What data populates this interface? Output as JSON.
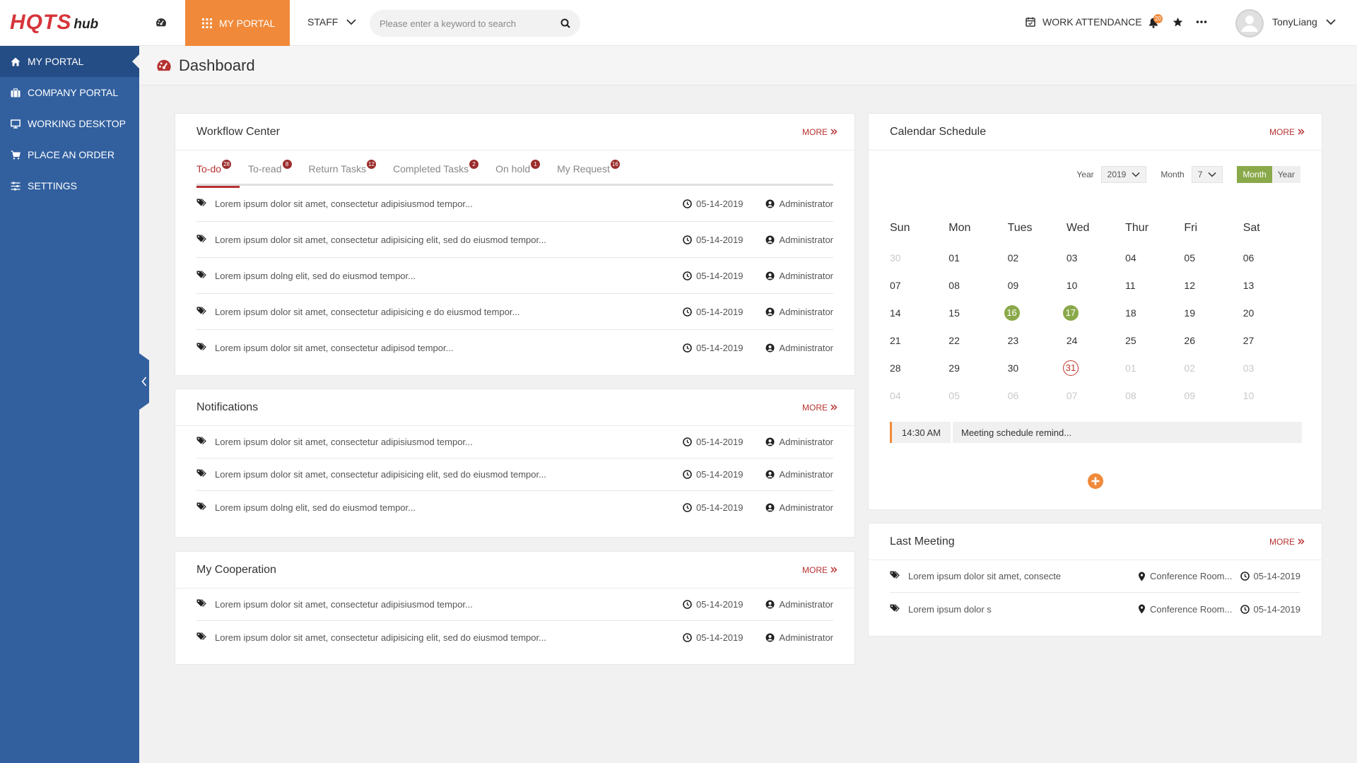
{
  "brand": {
    "logo_main": "HQTS",
    "logo_sub": "hub"
  },
  "topbar": {
    "portal_tab": "MY PORTAL",
    "staff_menu": "STAFF",
    "search_placeholder": "Please enter a keyword to search",
    "work_attendance": "WORK ATTENDANCE",
    "notification_count": "20",
    "username": "TonyLiang"
  },
  "sidebar": {
    "items": [
      {
        "label": "MY PORTAL",
        "icon": "home-icon"
      },
      {
        "label": "COMPANY PORTAL",
        "icon": "briefcase-icon"
      },
      {
        "label": "WORKING DESKTOP",
        "icon": "monitor-icon"
      },
      {
        "label": "PLACE AN ORDER",
        "icon": "cart-icon"
      },
      {
        "label": "SETTINGS",
        "icon": "sliders-icon"
      }
    ]
  },
  "page": {
    "title": "Dashboard"
  },
  "common": {
    "more": "MORE"
  },
  "workflow": {
    "title": "Workflow Center",
    "tabs": [
      {
        "label": "To-do",
        "count": "28"
      },
      {
        "label": "To-read",
        "count": "8"
      },
      {
        "label": "Return Tasks",
        "count": "12"
      },
      {
        "label": "Completed Tasks",
        "count": "2"
      },
      {
        "label": "On hold",
        "count": "1"
      },
      {
        "label": "My Request",
        "count": "16"
      }
    ],
    "rows": [
      {
        "text": "Lorem ipsum dolor sit amet, consectetur adipisiusmod tempor...",
        "date": "05-14-2019",
        "user": "Administrator"
      },
      {
        "text": "Lorem ipsum dolor sit amet, consectetur adipisicing elit, sed do eiusmod tempor...",
        "date": "05-14-2019",
        "user": "Administrator"
      },
      {
        "text": "Lorem ipsum dolng elit, sed do eiusmod tempor...",
        "date": "05-14-2019",
        "user": "Administrator"
      },
      {
        "text": "Lorem ipsum dolor sit amet, consectetur adipisicing e do eiusmod tempor...",
        "date": "05-14-2019",
        "user": "Administrator"
      },
      {
        "text": "Lorem ipsum dolor sit amet, consectetur adipisod tempor...",
        "date": "05-14-2019",
        "user": "Administrator"
      }
    ]
  },
  "notifications": {
    "title": "Notifications",
    "rows": [
      {
        "text": "Lorem ipsum dolor sit amet, consectetur adipisiusmod tempor...",
        "date": "05-14-2019",
        "user": "Administrator"
      },
      {
        "text": "Lorem ipsum dolor sit amet, consectetur adipisicing elit, sed do eiusmod tempor...",
        "date": "05-14-2019",
        "user": "Administrator"
      },
      {
        "text": "Lorem ipsum dolng elit, sed do eiusmod tempor...",
        "date": "05-14-2019",
        "user": "Administrator"
      }
    ]
  },
  "cooperation": {
    "title": "My Cooperation",
    "rows": [
      {
        "text": "Lorem ipsum dolor sit amet, consectetur adipisiusmod tempor...",
        "date": "05-14-2019",
        "user": "Administrator"
      },
      {
        "text": "Lorem ipsum dolor sit amet, consectetur adipisicing elit, sed do eiusmod tempor...",
        "date": "05-14-2019",
        "user": "Administrator"
      }
    ]
  },
  "calendar": {
    "title": "Calendar Schedule",
    "year_label": "Year",
    "year_value": "2019",
    "month_label": "Month",
    "month_value": "7",
    "view_month": "Month",
    "view_year": "Year",
    "weekdays": [
      "Sun",
      "Mon",
      "Tues",
      "Wed",
      "Thur",
      "Fri",
      "Sat"
    ],
    "weeks": [
      [
        [
          "30",
          "dim"
        ],
        [
          "01",
          ""
        ],
        [
          "02",
          ""
        ],
        [
          "03",
          ""
        ],
        [
          "04",
          ""
        ],
        [
          "05",
          ""
        ],
        [
          "06",
          ""
        ]
      ],
      [
        [
          "07",
          ""
        ],
        [
          "08",
          ""
        ],
        [
          "09",
          ""
        ],
        [
          "10",
          ""
        ],
        [
          "11",
          ""
        ],
        [
          "12",
          ""
        ],
        [
          "13",
          ""
        ]
      ],
      [
        [
          "14",
          ""
        ],
        [
          "15",
          ""
        ],
        [
          "16",
          "hl"
        ],
        [
          "17",
          "hl"
        ],
        [
          "18",
          ""
        ],
        [
          "19",
          ""
        ],
        [
          "20",
          ""
        ]
      ],
      [
        [
          "21",
          ""
        ],
        [
          "22",
          ""
        ],
        [
          "23",
          ""
        ],
        [
          "24",
          ""
        ],
        [
          "25",
          ""
        ],
        [
          "26",
          ""
        ],
        [
          "27",
          ""
        ]
      ],
      [
        [
          "28",
          ""
        ],
        [
          "29",
          ""
        ],
        [
          "30",
          ""
        ],
        [
          "31",
          "today"
        ],
        [
          "01",
          "dim"
        ],
        [
          "02",
          "dim"
        ],
        [
          "03",
          "dim"
        ]
      ],
      [
        [
          "04",
          "dim"
        ],
        [
          "05",
          "dim"
        ],
        [
          "06",
          "dim"
        ],
        [
          "07",
          "dim"
        ],
        [
          "08",
          "dim"
        ],
        [
          "09",
          "dim"
        ],
        [
          "10",
          "dim"
        ]
      ]
    ],
    "event": {
      "time": "14:30 AM",
      "text": "Meeting schedule remind..."
    }
  },
  "meeting": {
    "title": "Last Meeting",
    "rows": [
      {
        "text": "Lorem ipsum dolor sit amet, consecte",
        "location": "Conference Room...",
        "date": "05-14-2019"
      },
      {
        "text": "Lorem ipsum dolor s",
        "location": "Conference Room...",
        "date": "05-14-2019"
      }
    ]
  },
  "colors": {
    "sidebar": "#32609f",
    "accent": "#f08a3a",
    "brand_red": "#b73131",
    "calendar_green": "#8aa94a"
  }
}
